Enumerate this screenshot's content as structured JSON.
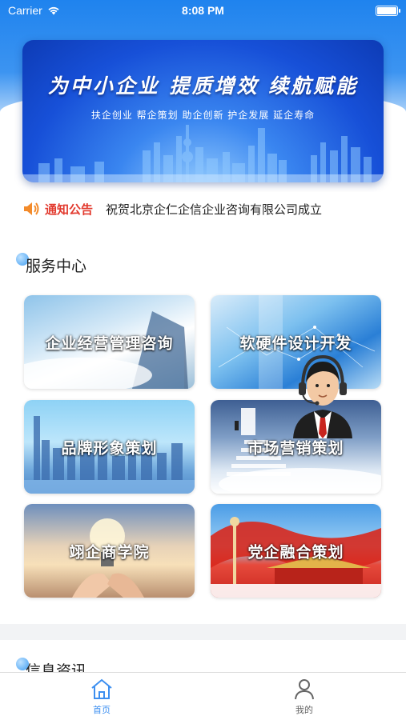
{
  "status_bar": {
    "carrier": "Carrier",
    "time": "8:08 PM"
  },
  "banner": {
    "slogan": "为中小企业  提质增效  续航赋能",
    "subtitle": "扶企创业  帮企策划  助企创新  护企发展  延企寿命"
  },
  "notice": {
    "tag": "通知公告",
    "text": "祝贺北京企仁企信企业咨询有限公司成立"
  },
  "services": {
    "title": "服务中心",
    "items": [
      {
        "label": "企业经营管理咨询"
      },
      {
        "label": "软硬件设计开发"
      },
      {
        "label": "品牌形象策划"
      },
      {
        "label": "市场营销策划"
      },
      {
        "label": "翊企商学院"
      },
      {
        "label": "党企融合策划"
      }
    ]
  },
  "news": {
    "title": "信息资讯"
  },
  "tabbar": {
    "home": "首页",
    "mine": "我的"
  },
  "colors": {
    "accent": "#3d8ff0",
    "notice_red": "#e23a2e"
  }
}
